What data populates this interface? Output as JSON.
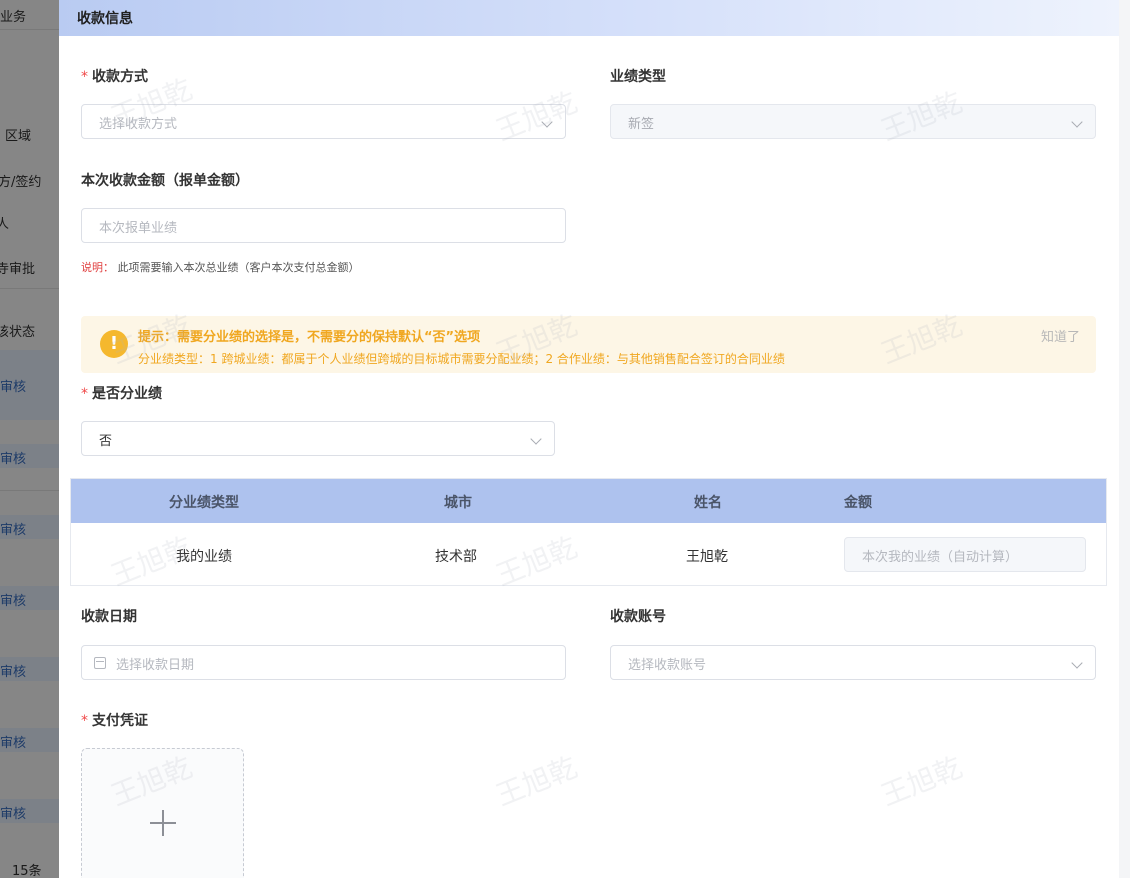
{
  "background": {
    "items": [
      "业务",
      "区域",
      "方/签约",
      "人",
      "寺审批",
      "该状态",
      "审核",
      "审核",
      "审核",
      "审核",
      "审核",
      "审核",
      "审核",
      "15条"
    ]
  },
  "section": {
    "title": "收款信息"
  },
  "payment_method": {
    "label": "收款方式",
    "placeholder": "选择收款方式",
    "required": true
  },
  "performance_type": {
    "label": "业绩类型",
    "value": "新签",
    "disabled": true
  },
  "amount": {
    "label": "本次收款金额（报单金额）",
    "placeholder": "本次报单业绩"
  },
  "amount_hint": {
    "key": "说明：",
    "text": "此项需要输入本次总业绩（客户本次支付总金额）"
  },
  "alert": {
    "title": "提示：需要分业绩的选择是，不需要分的保持默认“否”选项",
    "desc": "分业绩类型：1 跨城业绩：都属于个人业绩但跨城的目标城市需要分配业绩；2 合作业绩：与其他销售配合签订的合同业绩",
    "close": "知道了",
    "icon": "exclamation-icon",
    "color": "#f5b82e"
  },
  "split": {
    "label": "是否分业绩",
    "value": "否",
    "required": true
  },
  "table": {
    "headers": [
      "分业绩类型",
      "城市",
      "姓名",
      "金额"
    ],
    "row": {
      "type": "我的业绩",
      "city": "技术部",
      "name": "王旭乾",
      "amount_placeholder": "本次我的业绩（自动计算）"
    }
  },
  "date": {
    "label": "收款日期",
    "placeholder": "选择收款日期"
  },
  "account": {
    "label": "收款账号",
    "placeholder": "选择收款账号"
  },
  "voucher": {
    "label": "支付凭证",
    "required": true
  },
  "watermark": "王旭乾"
}
